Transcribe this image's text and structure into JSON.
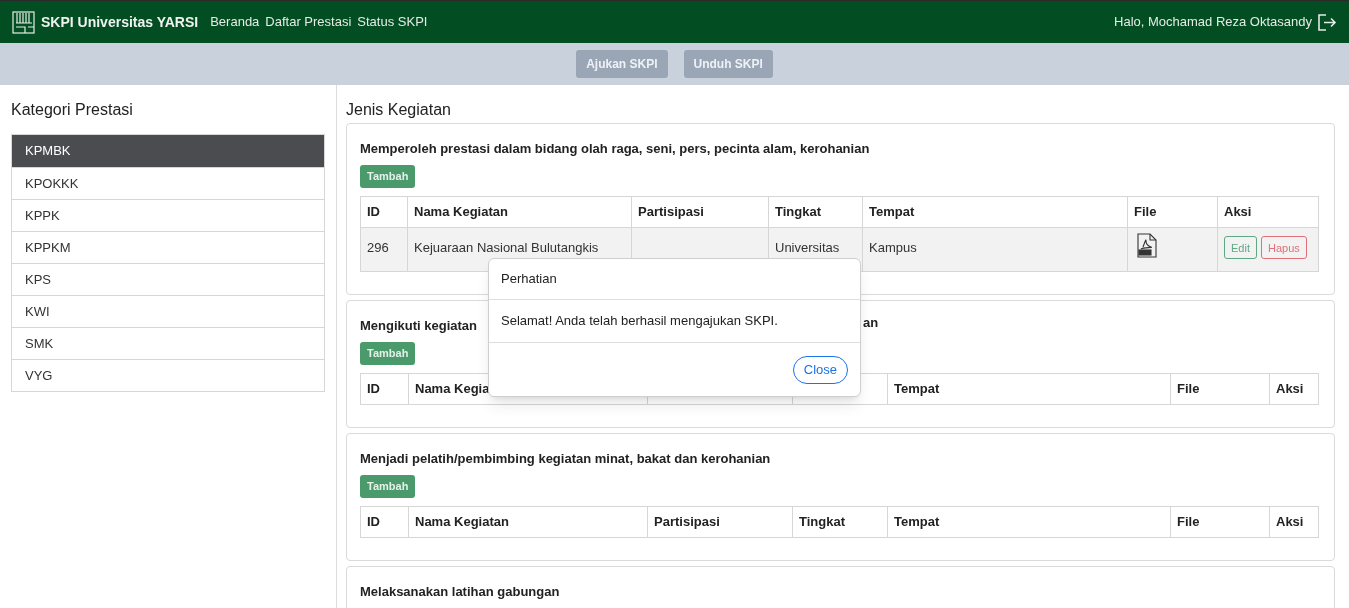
{
  "navbar": {
    "brand": "SKPI Universitas YARSI",
    "links": [
      "Beranda",
      "Daftar Prestasi",
      "Status SKPI"
    ],
    "greeting": "Halo, Mochamad Reza Oktasandy"
  },
  "toolbar": {
    "buttons": [
      {
        "label": "Ajukan SKPI",
        "disabled": true
      },
      {
        "label": "Unduh SKPI",
        "disabled": true
      }
    ]
  },
  "sidebar": {
    "title": "Kategori Prestasi",
    "items": [
      {
        "label": "KPMBK",
        "selected": true
      },
      {
        "label": "KPOKKK",
        "selected": false
      },
      {
        "label": "KPPK",
        "selected": false
      },
      {
        "label": "KPPKM",
        "selected": false
      },
      {
        "label": "KPS",
        "selected": false
      },
      {
        "label": "KWI",
        "selected": false
      },
      {
        "label": "SMK",
        "selected": false
      },
      {
        "label": "VYG",
        "selected": false
      }
    ]
  },
  "main": {
    "title": "Jenis Kegiatan",
    "sections": [
      {
        "title": "Memperoleh prestasi dalam bidang olah raga, seni, pers, pecinta alam, kerohanian",
        "add_button": "Tambah",
        "columns": [
          "ID",
          "Nama Kegiatan",
          "Partisipasi",
          "Tingkat",
          "Tempat",
          "File",
          "Aksi"
        ],
        "rows": [
          {
            "id": "296",
            "name": "Kejuaraan Nasional Bulutangkis",
            "tingkat": "Universitas",
            "tempat": "Kampus",
            "edit": "Edit",
            "delete": "Hapus"
          }
        ]
      },
      {
        "title": "Mengikuti kegiatan",
        "title_end": "an",
        "add_button": "Tambah",
        "columns": [
          "ID",
          "Nama Kegia",
          null,
          null,
          "Tempat",
          "File",
          "Aksi"
        ]
      },
      {
        "title": "Menjadi pelatih/pembimbing kegiatan minat, bakat dan kerohanian",
        "add_button": "Tambah",
        "columns": [
          "ID",
          "Nama Kegiatan",
          "Partisipasi",
          "Tingkat",
          "Tempat",
          "File",
          "Aksi"
        ]
      },
      {
        "title": "Melaksanakan latihan gabungan"
      }
    ]
  },
  "modal": {
    "title": "Perhatian",
    "message": "Selamat! Anda telah berhasil mengajukan SKPI.",
    "button": "Close"
  }
}
